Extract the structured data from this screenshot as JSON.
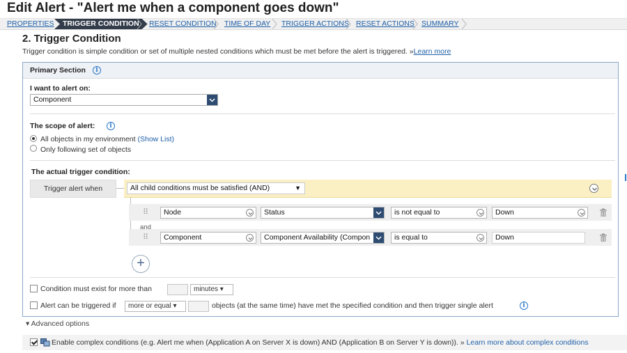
{
  "page": {
    "title": "Edit Alert - \"Alert me when a component goes down\""
  },
  "wizard": {
    "steps": [
      "PROPERTIES",
      "TRIGGER CONDITION",
      "RESET CONDITION",
      "TIME OF DAY",
      "TRIGGER ACTIONS",
      "RESET ACTIONS",
      "SUMMARY"
    ],
    "active_index": 1
  },
  "section": {
    "title": "2. Trigger Condition",
    "description": "Trigger condition is simple condition or set of multiple nested conditions which must be met before the alert is triggered. »",
    "learn_more": "Learn more"
  },
  "primary": {
    "header": "Primary Section",
    "alert_on_label": "I want to alert on:",
    "alert_on_value": "Component",
    "scope_label": "The scope of alert:",
    "scope_options": [
      "All objects in my environment",
      "Only following set of objects"
    ],
    "scope_selected": 0,
    "show_list": "(Show List)"
  },
  "trigger": {
    "label": "The actual trigger condition:",
    "when_label": "Trigger alert when",
    "group_value": "All child conditions must be satisfied (AND)",
    "and_label": "and",
    "conditions": [
      {
        "object": "Node",
        "property": "Status",
        "operator": "is not equal to",
        "value": "Down"
      },
      {
        "object": "Component",
        "property": "Component Availability (Compon",
        "operator": "is equal to",
        "value": "Down"
      }
    ],
    "add_symbol": "+"
  },
  "options": {
    "exist_label": "Condition must exist for more than",
    "exist_unit": "minutes ▾",
    "exist_checked": false,
    "trigger_if_label": "Alert can be triggered if",
    "trigger_if_select": "more or equal ▾",
    "trigger_if_rest": "objects (at the same time) have met the specified condition and then trigger single alert",
    "trigger_if_checked": false
  },
  "advanced": {
    "toggle_label": "▾  Advanced options",
    "complex_label": "Enable complex conditions (e.g. Alert me when (Application A on Server X is down) AND (Application B on Server Y is down)). »",
    "complex_link": "Learn more about complex conditions",
    "complex_checked": true
  },
  "colors": {
    "accent": "#1e5fa8",
    "active_step_bg": "#323c4a",
    "yellow_bar": "#fbf0c4",
    "dropdown_btn": "#2e4c72"
  }
}
